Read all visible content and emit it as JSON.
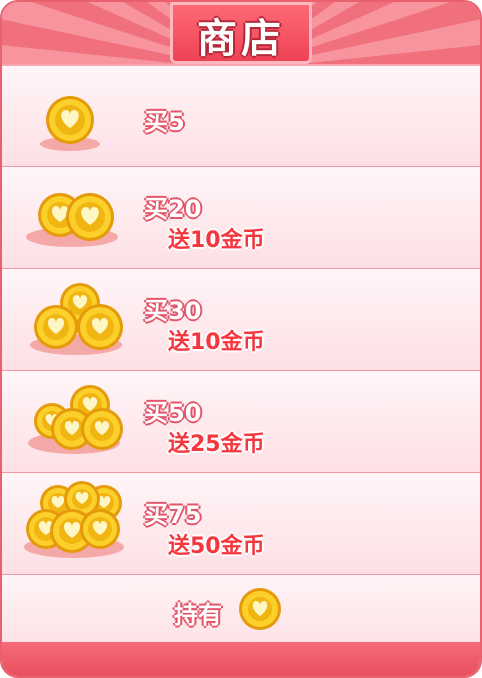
{
  "shop": {
    "title": "商店",
    "colors": {
      "accent": "#ec4152",
      "bonus_text": "#f4363f",
      "coin": "#f7c21a"
    },
    "items": [
      {
        "buy": "买5",
        "bonus": "",
        "icon": "single-coin-icon"
      },
      {
        "buy": "买20",
        "bonus": "送10金币",
        "icon": "coin-stack-icon"
      },
      {
        "buy": "买30",
        "bonus": "送10金币",
        "icon": "coin-pile-icon"
      },
      {
        "buy": "买50",
        "bonus": "送25金币",
        "icon": "coin-heap-icon"
      },
      {
        "buy": "买75",
        "bonus": "送50金币",
        "icon": "coin-mountain-icon"
      }
    ],
    "holding": {
      "label": "持有",
      "icon": "heart-coin-icon"
    }
  }
}
